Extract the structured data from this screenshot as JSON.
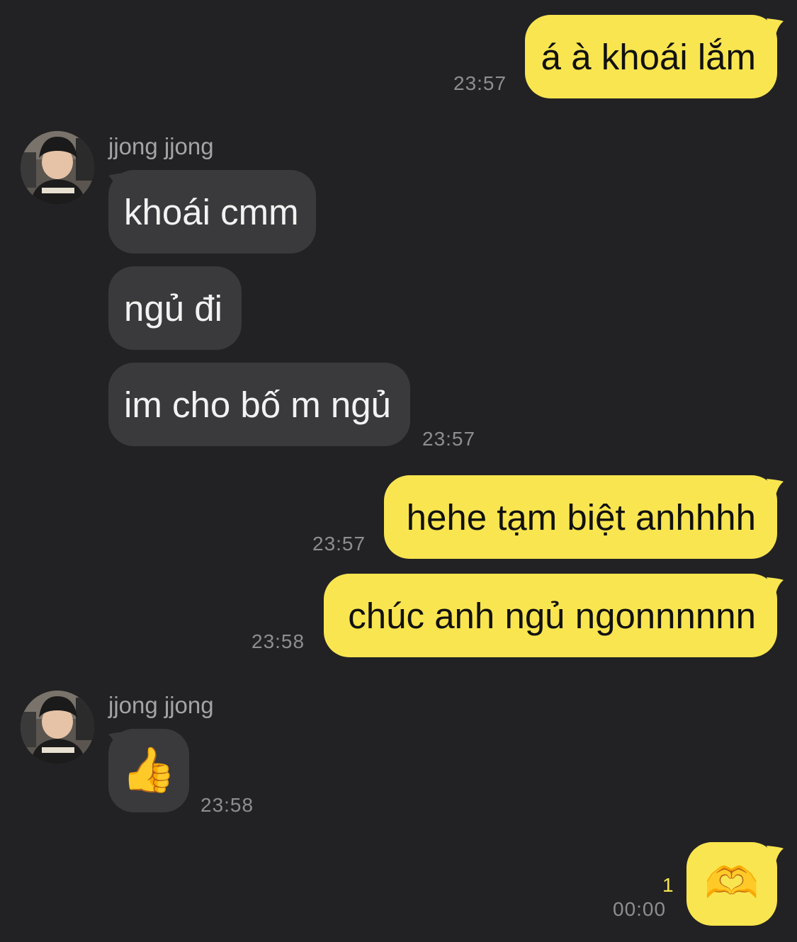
{
  "contact": {
    "name": "jjong jjong"
  },
  "messages": [
    {
      "dir": "out",
      "text": "á à khoái lắm",
      "time": "23:57"
    },
    {
      "dir": "in",
      "text": "khoái cmm"
    },
    {
      "dir": "in",
      "text": "ngủ đi"
    },
    {
      "dir": "in",
      "text": "im cho bố m ngủ",
      "time": "23:57"
    },
    {
      "dir": "out",
      "text": "hehe tạm biệt anhhhh",
      "time": "23:57"
    },
    {
      "dir": "out",
      "text": "chúc anh ngủ ngonnnnnn",
      "time": "23:58"
    },
    {
      "dir": "in",
      "text": "👍",
      "time": "23:58"
    },
    {
      "dir": "out",
      "text": "🫶",
      "time": "00:00",
      "unread": "1"
    }
  ],
  "colors": {
    "background": "#222224",
    "outgoing_bubble": "#f9e54f",
    "incoming_bubble": "#3a3a3c",
    "timestamp": "#8e8e92",
    "unread_count": "#f9e54f"
  },
  "icons": {
    "avatar": "profile-photo",
    "thumbs_up": "thumbs-up-emoji",
    "heart_hands": "heart-hands-emoji"
  }
}
